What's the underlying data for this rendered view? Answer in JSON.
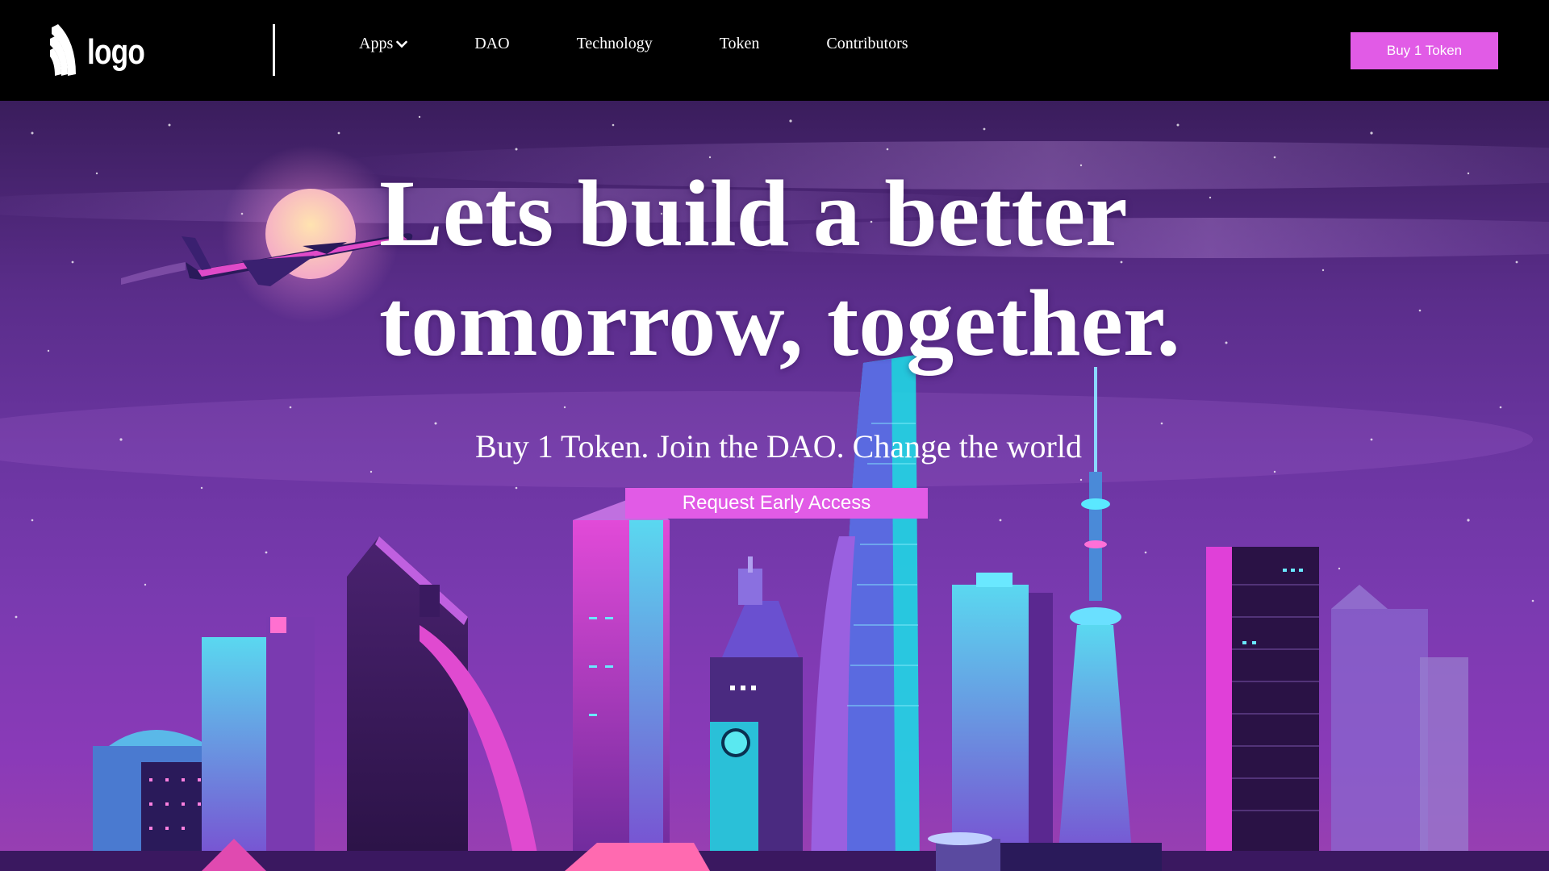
{
  "brand": {
    "logo_text": "logo"
  },
  "nav": {
    "items": [
      {
        "label": "Apps",
        "has_dropdown": true
      },
      {
        "label": "DAO"
      },
      {
        "label": "Technology"
      },
      {
        "label": "Token"
      },
      {
        "label": "Contributors"
      }
    ],
    "buy_label": "Buy 1 Token"
  },
  "hero": {
    "headline_line1": "Lets build a better",
    "headline_line2": "tomorrow, together.",
    "subline": "Buy 1 Token. Join the DAO. Change the world",
    "cta_label": "Request Early Access"
  },
  "colors": {
    "accent": "#e15be6",
    "nav_bg": "#000000",
    "hero_top": "#3a1d5c",
    "hero_bottom": "#9a40b0"
  },
  "icons": {
    "logo_mark": "stacked-arcs-icon",
    "apps_dropdown": "chevron-down-icon"
  }
}
